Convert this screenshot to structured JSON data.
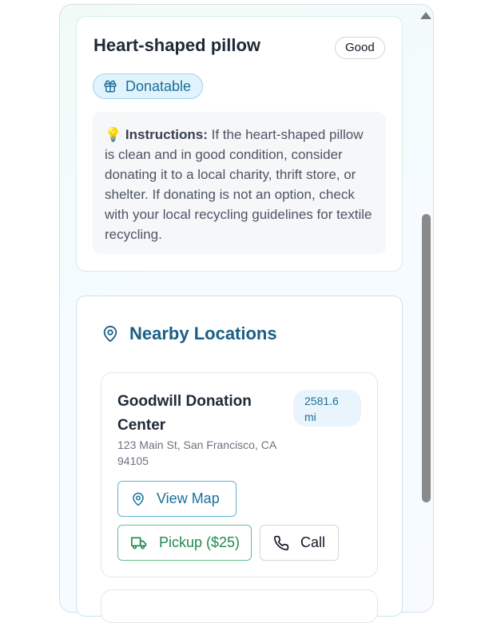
{
  "item": {
    "title": "Heart-shaped pillow",
    "condition": "Good",
    "category_badge": "Donatable",
    "instructions_lead": "Instructions:",
    "instructions_text": "If the heart-shaped pillow is clean and in good condition, consider donating it to a local charity, thrift store, or shelter. If donating is not an option, check with your local recycling guidelines for textile recycling.",
    "instructions_icon": "lightbulb-icon"
  },
  "locations": {
    "heading": "Nearby Locations",
    "items": [
      {
        "name": "Goodwill Donation Center",
        "distance": "2581.6 mi",
        "address": "123 Main St, San Francisco, CA 94105",
        "view_map_label": "View Map",
        "pickup_label": "Pickup ($25)",
        "call_label": "Call"
      }
    ]
  },
  "colors": {
    "accent_blue": "#1a6f99",
    "accent_green": "#1e8a51",
    "heading_blue": "#1a5f86"
  }
}
